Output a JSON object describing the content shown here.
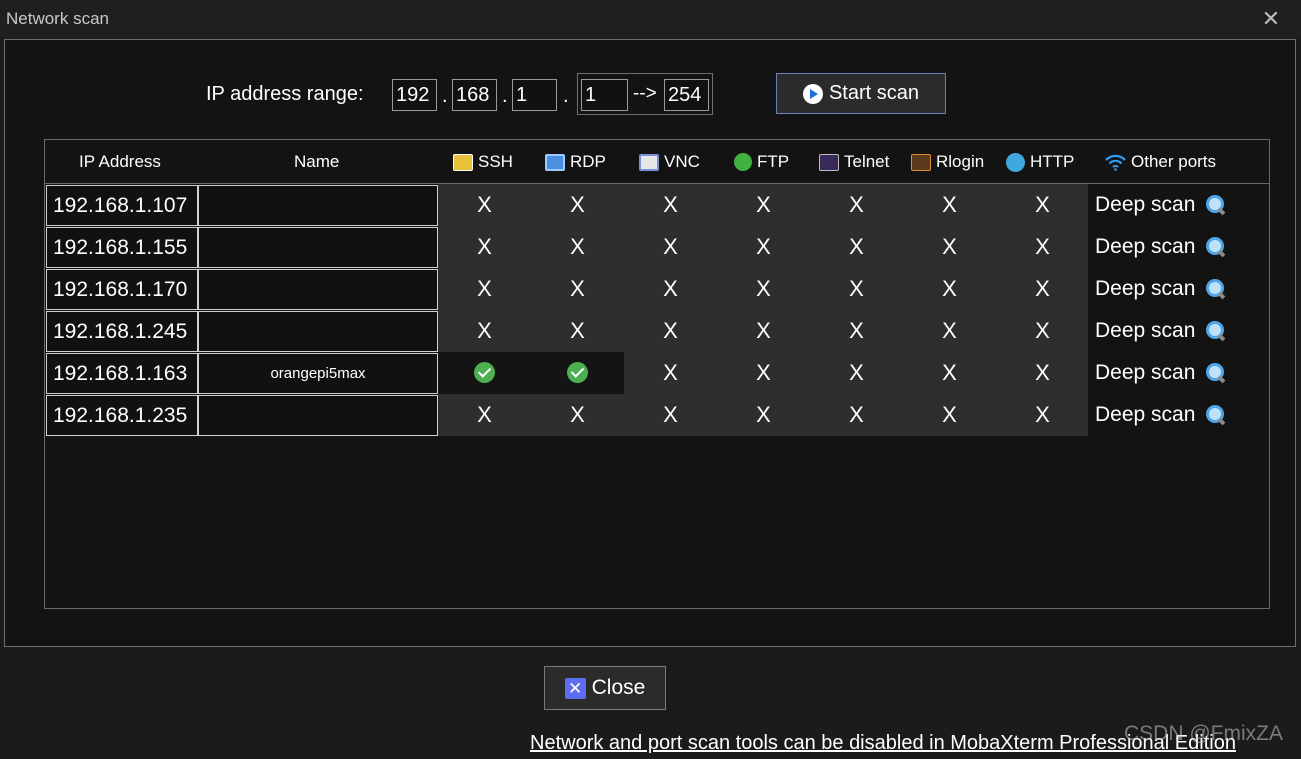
{
  "window": {
    "title": "Network scan",
    "close_glyph": "✕"
  },
  "range": {
    "label": "IP address range:",
    "octet1": "192",
    "octet2": "168",
    "octet3": "1",
    "from": "1",
    "arrow": "-->",
    "to": "254",
    "dot": "."
  },
  "start_button": {
    "label": "Start scan",
    "icon": "play-icon"
  },
  "columns": {
    "ip": "IP Address",
    "name": "Name",
    "ssh": "SSH",
    "rdp": "RDP",
    "vnc": "VNC",
    "ftp": "FTP",
    "telnet": "Telnet",
    "rlogin": "Rlogin",
    "http": "HTTP",
    "other": "Other ports"
  },
  "closed_mark": "X",
  "deep_scan_label": "Deep scan",
  "rows": [
    {
      "ip": "192.168.1.107",
      "name": "",
      "ports": [
        false,
        false,
        false,
        false,
        false,
        false,
        false
      ]
    },
    {
      "ip": "192.168.1.155",
      "name": "",
      "ports": [
        false,
        false,
        false,
        false,
        false,
        false,
        false
      ]
    },
    {
      "ip": "192.168.1.170",
      "name": "",
      "ports": [
        false,
        false,
        false,
        false,
        false,
        false,
        false
      ]
    },
    {
      "ip": "192.168.1.245",
      "name": "",
      "ports": [
        false,
        false,
        false,
        false,
        false,
        false,
        false
      ]
    },
    {
      "ip": "192.168.1.163",
      "name": "orangepi5max",
      "ports": [
        true,
        true,
        false,
        false,
        false,
        false,
        false
      ]
    },
    {
      "ip": "192.168.1.235",
      "name": "",
      "ports": [
        false,
        false,
        false,
        false,
        false,
        false,
        false
      ]
    }
  ],
  "close_button": {
    "label": "Close",
    "glyph": "✕"
  },
  "footer": {
    "link": "Network and port scan tools can be disabled in MobaXterm Professional Edition"
  },
  "watermark": "CSDN @FmixZA",
  "colors": {
    "accent": "#6c7fb7",
    "open_port": "#4caf50",
    "close_icon": "#5b6df0"
  }
}
